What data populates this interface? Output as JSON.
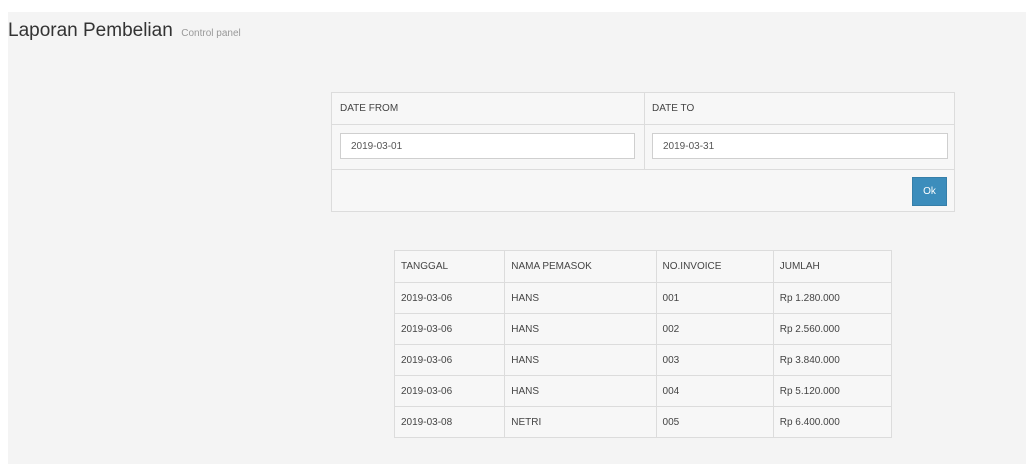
{
  "header": {
    "title": "Laporan Pembelian",
    "subtitle": "Control panel"
  },
  "filter": {
    "date_from_label": "DATE FROM",
    "date_to_label": "DATE TO",
    "date_from_value": "2019-03-01",
    "date_to_value": "2019-03-31",
    "ok_label": "Ok"
  },
  "table": {
    "headers": [
      "TANGGAL",
      "NAMA PEMASOK",
      "NO.INVOICE",
      "JUMLAH"
    ],
    "rows": [
      [
        "2019-03-06",
        "HANS",
        "001",
        "Rp 1.280.000"
      ],
      [
        "2019-03-06",
        "HANS",
        "002",
        "Rp 2.560.000"
      ],
      [
        "2019-03-06",
        "HANS",
        "003",
        "Rp 3.840.000"
      ],
      [
        "2019-03-06",
        "HANS",
        "004",
        "Rp 5.120.000"
      ],
      [
        "2019-03-08",
        "NETRI",
        "005",
        "Rp 6.400.000"
      ]
    ]
  },
  "colors": {
    "background": "#f4f4f4",
    "primary_button": "#3c8dbc",
    "border": "#dcdcdc"
  }
}
